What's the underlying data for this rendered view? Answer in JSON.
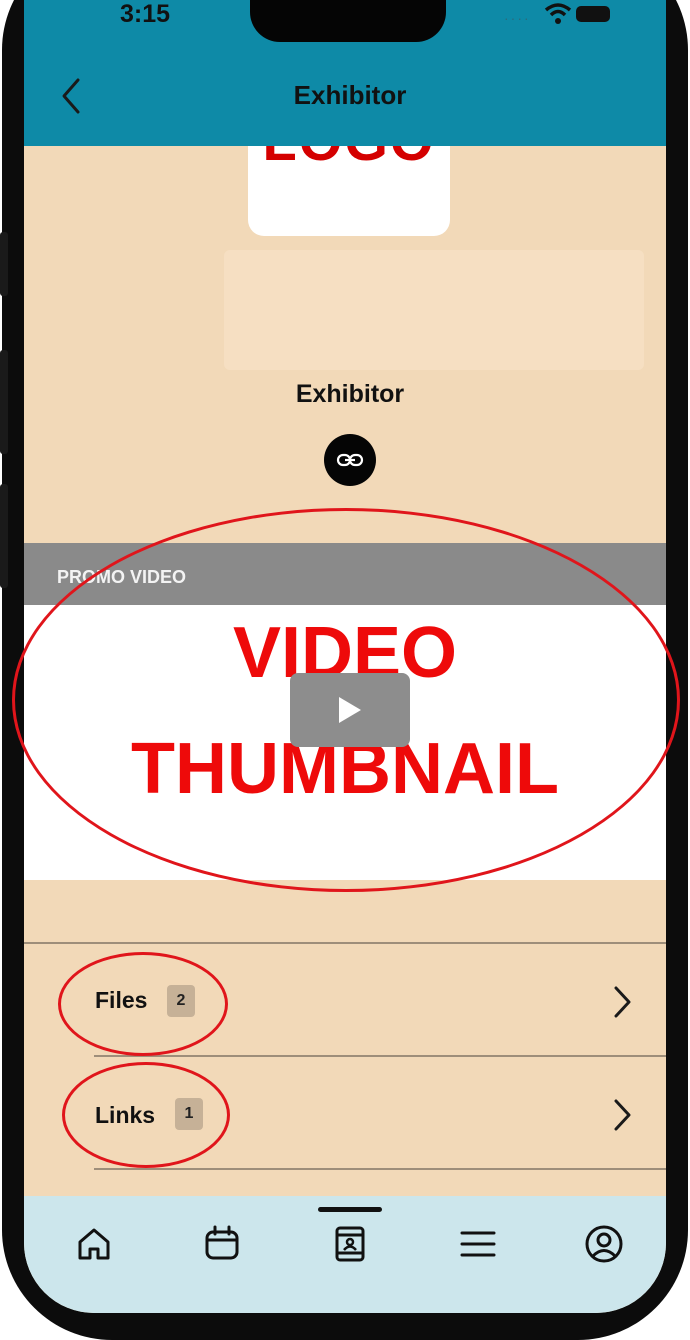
{
  "status_bar": {
    "time": "3:15"
  },
  "header": {
    "title": "Exhibitor"
  },
  "exhibitor": {
    "logo_text": "LOGO",
    "name": "Exhibitor"
  },
  "promo": {
    "section_label": "PROMO VIDEO",
    "thumbnail_line1": "VIDEO",
    "thumbnail_line2": "THUMBNAIL"
  },
  "rows": [
    {
      "label": "Files",
      "count": "2"
    },
    {
      "label": "Links",
      "count": "1"
    }
  ],
  "tabs": [
    {
      "icon": "home-icon"
    },
    {
      "icon": "calendar-icon"
    },
    {
      "icon": "exhibitor-book-icon",
      "active": true
    },
    {
      "icon": "menu-icon"
    },
    {
      "icon": "profile-icon"
    }
  ],
  "colors": {
    "header_bg": "#0e8aa7",
    "page_bg": "#f2d9b8",
    "tabbar_bg": "#cce6ec",
    "annotation_red": "#e0151b"
  }
}
